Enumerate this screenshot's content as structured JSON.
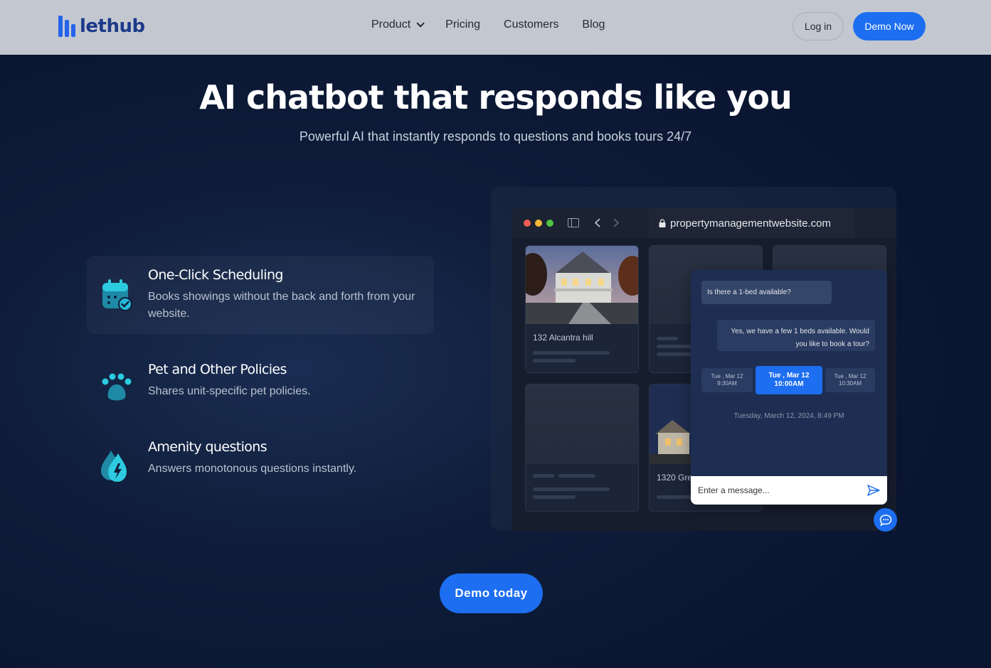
{
  "nav": {
    "logo_text": "lethub",
    "links": [
      {
        "label": "Product",
        "has_dropdown": true
      },
      {
        "label": "Pricing"
      },
      {
        "label": "Customers"
      },
      {
        "label": "Blog"
      }
    ],
    "login_label": "Log in",
    "demo_label": "Demo Now"
  },
  "hero": {
    "title": "AI chatbot that responds like you",
    "subtitle": "Powerful AI that instantly responds to questions and books tours 24/7"
  },
  "features": [
    {
      "title": "One-Click Scheduling",
      "description": "Books showings without the back and forth from your website.",
      "icon": "calendar-check-icon"
    },
    {
      "title": "Pet and Other Policies",
      "description": "Shares unit-specific pet policies.",
      "icon": "paw-icon"
    },
    {
      "title": "Amenity questions",
      "description": "Answers monotonous questions instantly.",
      "icon": "water-lightning-icon"
    }
  ],
  "mockup": {
    "url": "propertymanagementwebsite.com",
    "cards": [
      {
        "label": "132 Alcantra hill"
      },
      {
        "label": "1320 Gre"
      }
    ],
    "chat": {
      "user_message": "Is there a 1-bed available?",
      "bot_message_line1": "Yes, we have a few 1 beds available.  Would",
      "bot_message_line2": "you like to book a tour?",
      "slots": [
        {
          "date": "Tue , Mar 12",
          "time": "9:30AM",
          "selected": false
        },
        {
          "date": "Tue , Mar 12",
          "time": "10:00AM",
          "selected": true
        },
        {
          "date": "Tue , Mar 12",
          "time": "10:30AM",
          "selected": false
        }
      ],
      "timestamp": "Tuesday, March 12, 2024, 8:49 PM",
      "input_placeholder": "Enter a message..."
    }
  },
  "cta_label": "Demo today",
  "colors": {
    "accent": "#1d6ef0",
    "background": "#0f1d3a",
    "nav_background": "#c3c8d0"
  }
}
